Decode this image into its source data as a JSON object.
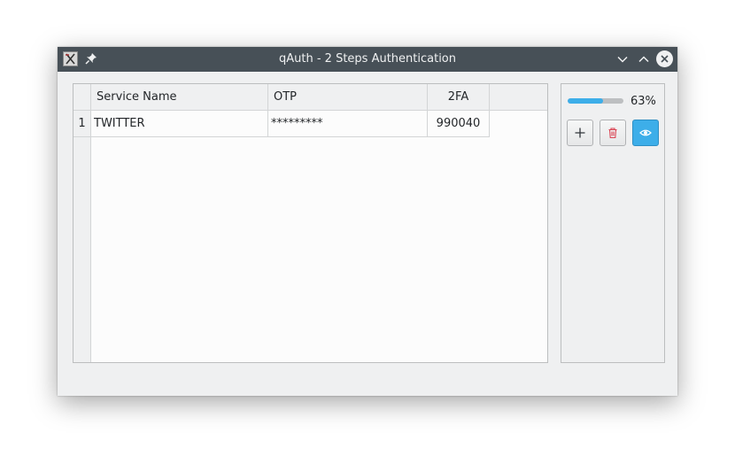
{
  "window": {
    "title": "qAuth - 2 Steps Authentication"
  },
  "table": {
    "columns": [
      "Service Name",
      "OTP",
      "2FA"
    ],
    "rows": [
      {
        "number": "1",
        "service": "TWITTER",
        "otp": "*********",
        "twofa": "990040"
      }
    ]
  },
  "side": {
    "progress_value": 63,
    "progress_text": "63%",
    "buttons": {
      "add_icon": "plus-icon",
      "delete_icon": "trash-icon",
      "show_icon": "eye-icon"
    }
  },
  "colors": {
    "titlebar": "#475057",
    "accent": "#3daee9",
    "delete_icon": "#da4453",
    "window_bg": "#eff0f1"
  }
}
